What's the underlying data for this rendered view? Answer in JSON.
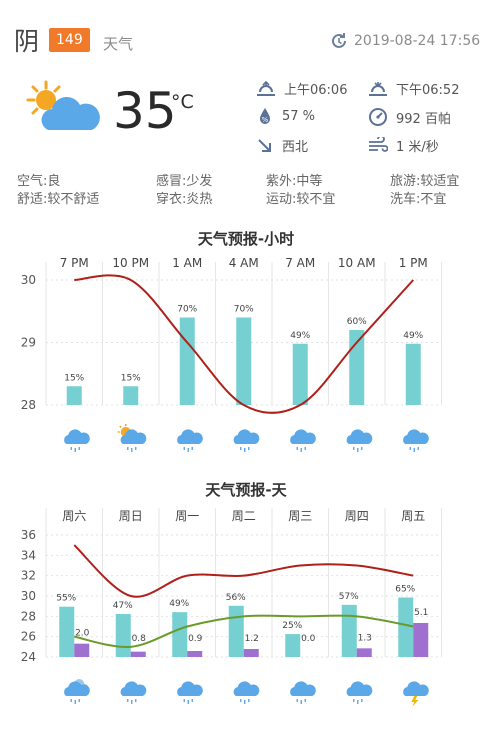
{
  "header": {
    "condition": "阴",
    "aqi": "149",
    "app_title": "天气",
    "updated": "2019-08-24 17:56"
  },
  "current": {
    "temperature": "35",
    "unit": "°C",
    "sunrise": "上午06:06",
    "sunset": "下午06:52",
    "humidity": "57 %",
    "pressure": "992 百帕",
    "wind_direction": "西北",
    "wind_speed": "1 米/秒"
  },
  "indices": [
    {
      "label": "空气:",
      "value": "良"
    },
    {
      "label": "感冒:",
      "value": "少发"
    },
    {
      "label": "紫外:",
      "value": "中等"
    },
    {
      "label": "旅游:",
      "value": "较适宜"
    },
    {
      "label": "舒适:",
      "value": "较不舒适"
    },
    {
      "label": "穿衣:",
      "value": "炎热"
    },
    {
      "label": "运动:",
      "value": "较不宜"
    },
    {
      "label": "洗车:",
      "value": "不宜"
    }
  ],
  "colors": {
    "temp_line": "#b0201a",
    "low_line": "#6a9a2a",
    "rain_bar": "#76cfd0",
    "precip_bar": "#a070d0",
    "aqi_badge": "#f07a2a",
    "icon_blue": "#5aa8e8",
    "sun": "#f5a623"
  },
  "chart_data": [
    {
      "type": "line",
      "title": "天气预报-小时",
      "categories": [
        "7 PM",
        "10 PM",
        "1 AM",
        "4 AM",
        "7 AM",
        "10 AM",
        "1 PM"
      ],
      "series": [
        {
          "values": [
            30,
            30,
            29,
            28,
            28,
            29,
            30
          ]
        },
        {
          "values": [
            15,
            15,
            70,
            70,
            49,
            60,
            49
          ]
        }
      ],
      "bar_labels": [
        "15%",
        "15%",
        "70%",
        "70%",
        "49%",
        "60%",
        "49%"
      ],
      "yticks": [
        "30",
        "29",
        "28"
      ],
      "ylim": [
        28,
        30
      ],
      "icons": [
        "rain-cloud-icon",
        "sun-cloud-rain-icon",
        "rain-cloud-icon",
        "rain-cloud-icon",
        "rain-cloud-icon",
        "rain-cloud-icon",
        "rain-cloud-icon"
      ]
    },
    {
      "type": "line",
      "title": "天气预报-天",
      "categories": [
        "周六",
        "周日",
        "周一",
        "周二",
        "周三",
        "周四",
        "周五"
      ],
      "series": [
        {
          "values": [
            35,
            30,
            32,
            32,
            33,
            33,
            32
          ]
        },
        {
          "values": [
            26,
            25,
            27,
            28,
            28,
            28,
            27
          ]
        },
        {
          "values": [
            55,
            47,
            49,
            56,
            25,
            57,
            65
          ]
        },
        {
          "values": [
            2.0,
            0.8,
            0.9,
            1.2,
            0.0,
            1.3,
            5.1
          ]
        }
      ],
      "bar_labels": [
        "55%",
        "47%",
        "49%",
        "56%",
        "25%",
        "57%",
        "65%"
      ],
      "precip_labels": [
        "2.0",
        "0.8",
        "0.9",
        "1.2",
        "0.0",
        "1.3",
        "5.1"
      ],
      "yticks": [
        "36",
        "34",
        "32",
        "30",
        "28",
        "26",
        "24"
      ],
      "ylim": [
        24,
        36
      ],
      "icons": [
        "cloud-rain-icon",
        "rain-cloud-icon",
        "rain-cloud-icon",
        "rain-cloud-icon",
        "rain-cloud-icon",
        "rain-cloud-icon",
        "thunder-cloud-icon"
      ]
    }
  ]
}
